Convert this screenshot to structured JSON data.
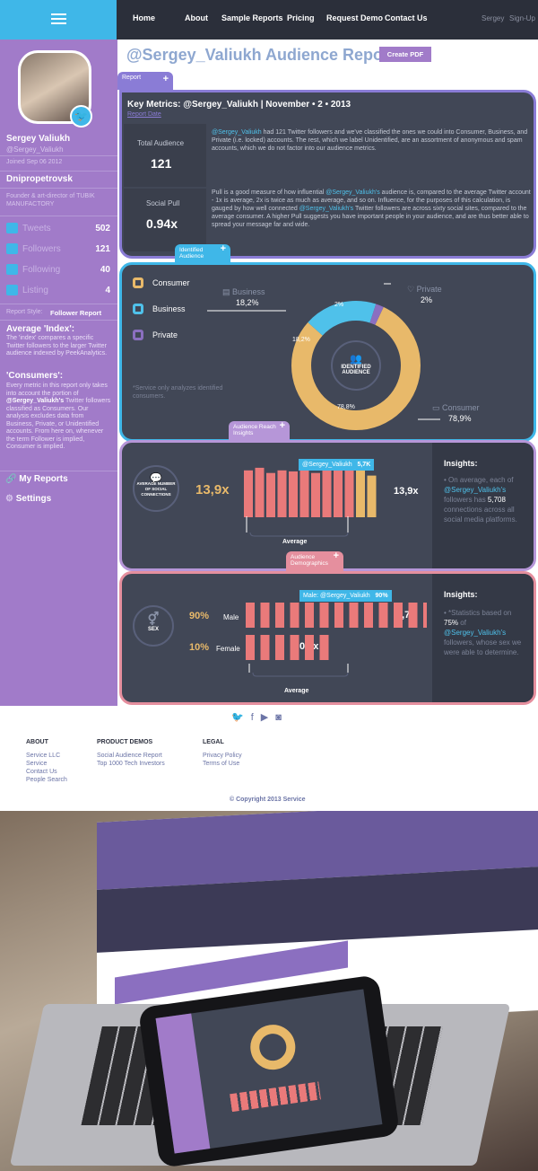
{
  "nav": {
    "home": "Home",
    "about": "About",
    "sample": "Sample Reports",
    "pricing": "Pricing",
    "request": "Request Demo",
    "contact": "Contact Us",
    "user": "Sergey",
    "signup": "Sign-Up"
  },
  "profile": {
    "name": "Sergey Valiukh",
    "handle": "@Sergey_Valiukh",
    "joined": "Joined Sep 06 2012",
    "city": "Dnipropetrovsk",
    "bio": "Founder & art-director of TUBIK MANUFACTORY"
  },
  "stats": [
    {
      "label": "Tweets",
      "value": "502"
    },
    {
      "label": "Followers",
      "value": "121"
    },
    {
      "label": "Following",
      "value": "40"
    },
    {
      "label": "Listing",
      "value": "4"
    }
  ],
  "report_style": {
    "label": "Report Style:",
    "value": "Follower Report"
  },
  "avg_index": {
    "title": "Average 'Index':",
    "text": "The 'index' compares a specific Twitter followers to the larger Twitter audience indexed by PeekAnalytics."
  },
  "consumers": {
    "title": "'Consumers':",
    "text1": "Every metric in this report only takes into account the portion of",
    "handle": "@Sergey_Valiukh's",
    "text2": "Twitter followers classified as Consumers. Our analysis excludes data from Business, Private, or Unidentified accounts. From here on, whenever the term Follower is implied, Consumer is implied."
  },
  "side_menu": {
    "reports": "My Reports",
    "settings": "Settings"
  },
  "header": {
    "title": "@Sergey_Valiukh Audience Report",
    "pdf": "Create PDF"
  },
  "report_tab": "Report",
  "key": {
    "title": "Key Metrics: @Sergey_Valiukh | November • 2 • 2013",
    "date": "Report Date",
    "total_label": "Total Audience",
    "total_value": "121",
    "pull_label": "Social Pull",
    "pull_value": "0.94x",
    "p1_handle": "@Sergey_Valiukh",
    "p1_text": "had 121 Twitter followers and we've classified the ones we could into Consumer, Business, and Private (i.e. locked) accounts. The rest, which we label Unidentified, are an assortment of anonymous and spam accounts, which we do not factor into our audience metrics.",
    "p2_a": "Pull is a good measure of how influential",
    "p2_handle": "@Sergey_Valiukh's",
    "p2_b": "audience is, compared to the average Twitter account - 1x is average, 2x is twice as much as average, and so on. Influence, for the purposes of this calculation, is gauged by how well connected",
    "p2_handle2": "@Sergey_Valiukh's",
    "p2_c": "Twitter followers are across sixty social sites, compared to the average consumer. A higher Pull suggests you have important people in your audience, and are thus better able to spread your message far and wide."
  },
  "identified": {
    "tab": "Identified Audience",
    "legend": [
      {
        "label": "Consumer",
        "color": "#e8b96a"
      },
      {
        "label": "Business",
        "color": "#4fc1ea"
      },
      {
        "label": "Private",
        "color": "#8b6fc0"
      }
    ],
    "business_label": "Business",
    "business_value": "18,2%",
    "private_label": "Private",
    "private_value": "2%",
    "consumer_label": "Consumer",
    "consumer_value": "78,9%",
    "inner_consumer": "78,8%",
    "inner_business": "18,2%",
    "inner_private": "2%",
    "center": "IDENTIFIED AUDIENCE",
    "note": "*Service only analyzes identified consumers.",
    "chart_data": {
      "type": "pie",
      "categories": [
        "Consumer",
        "Business",
        "Private"
      ],
      "values": [
        78.8,
        18.2,
        2
      ]
    }
  },
  "reach": {
    "tab": "Audience Reach Insights",
    "badge": "AVERAGE NUMBER OF SOCIAL CONNECTIONS",
    "left_value": "13,9x",
    "right_value": "13,9x",
    "tooltip": "@Sergey_Valiukh",
    "tooltip_value": "5,7K",
    "axis": "Average",
    "insights_title": "Insights:",
    "insights_a": "• On average, each of",
    "insights_handle": "@Sergey_Valiukh's",
    "insights_b": "followers has",
    "insights_num": "5,708",
    "insights_c": "connections across all social media platforms.",
    "chart_data": {
      "type": "bar",
      "values": [
        0.9,
        0.95,
        0.85,
        0.9,
        0.88,
        0.92,
        0.85,
        0.9,
        0.95,
        0.9,
        0.92,
        0.8
      ],
      "highlight": [
        10,
        11
      ]
    }
  },
  "demo": {
    "tab": "Audience Demographics",
    "badge": "SEX",
    "male_pct": "90%",
    "male_label": "Male",
    "male_value": "1,7x",
    "female_pct": "10%",
    "female_label": "Female",
    "female_value": "0,2x",
    "tooltip": "Male: @Sergey_Valiukh",
    "tooltip_value": "90%",
    "axis": "Average",
    "insights_title": "Insights:",
    "insights_a": "• *Statistics based on",
    "insights_num": "75%",
    "insights_b": "of",
    "insights_handle": "@Sergey_Valiukh's",
    "insights_c": "followers, whose sex we were able to determine.",
    "chart_data": {
      "type": "bar",
      "series": [
        {
          "name": "Male",
          "values": [
            1,
            1,
            1,
            1,
            1,
            1,
            1,
            1,
            1,
            1,
            1,
            1,
            1,
            1,
            1,
            1
          ]
        },
        {
          "name": "Female",
          "values": [
            1,
            1,
            1,
            1,
            1,
            1
          ]
        }
      ]
    }
  },
  "footer": {
    "about": "ABOUT",
    "about_links": [
      "Service LLC",
      "Service",
      "Contact Us",
      "People Search"
    ],
    "demos": "PRODUCT DEMOS",
    "demo_links": [
      "Social Audience Report",
      "Top 1000 Tech Investors"
    ],
    "legal": "LEGAL",
    "legal_links": [
      "Privacy Policy",
      "Terms of Use"
    ],
    "copyright": "© Copyright 2013 Service"
  },
  "colors": {
    "purple": "#a17bc9",
    "blue": "#3fb7e8",
    "dark": "#414756",
    "orange": "#e8b96a",
    "salmon": "#ea7a7a"
  }
}
